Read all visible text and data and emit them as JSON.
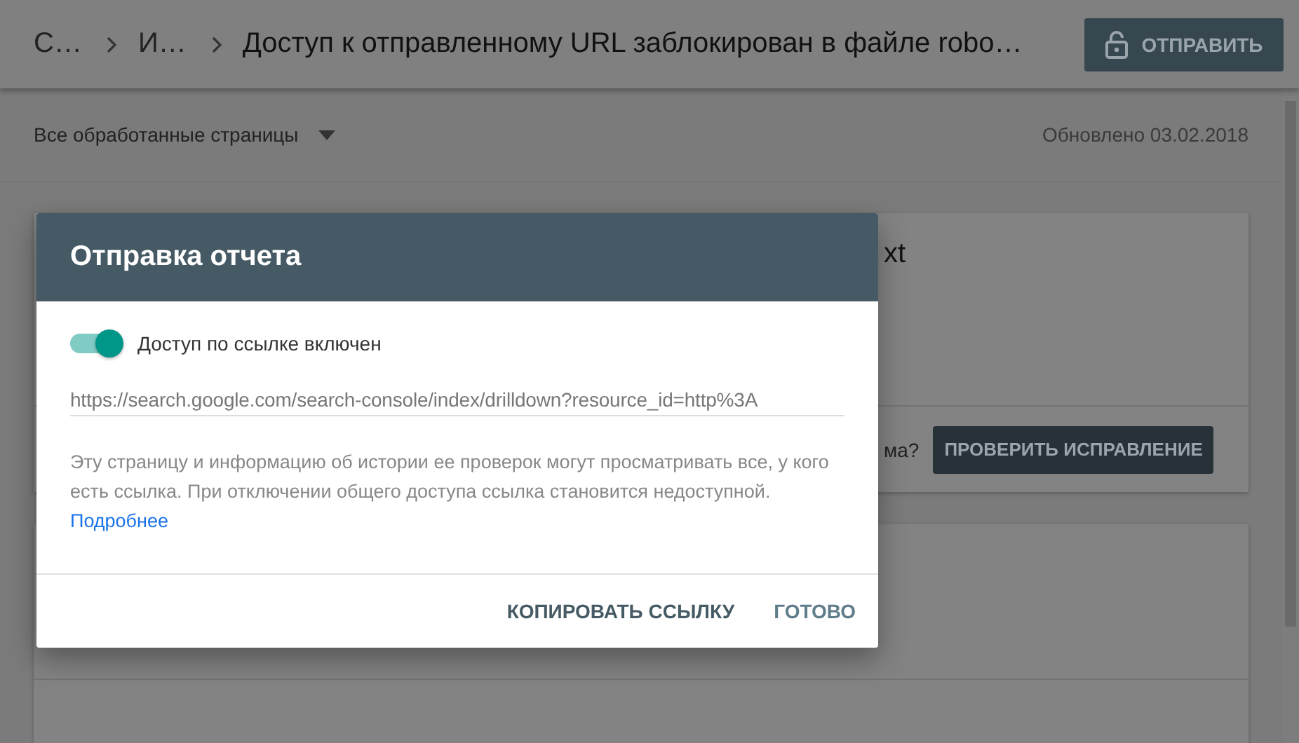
{
  "header": {
    "breadcrumbs": [
      "С…",
      "И…"
    ],
    "title": "Доступ к отправленному URL заблокирован в файле robo…",
    "submit_button": "ОТПРАВИТЬ"
  },
  "toolbar": {
    "filter": "Все обработанные страницы",
    "updated": "Обновлено 03.02.2018"
  },
  "background": {
    "card_title_fragment": "xt",
    "question_fragment": "ма?",
    "validate_button": "ПРОВЕРИТЬ ИСПРАВЛЕНИЕ"
  },
  "dialog": {
    "title": "Отправка отчета",
    "sharing": {
      "label": "Доступ по ссылке включен",
      "on": true
    },
    "link": "https://search.google.com/search-console/index/drilldown?resource_id=http%3A",
    "description": "Эту страницу и информацию об истории ее проверок могут просматривать все, у кого есть ссылка. При отключении общего доступа ссылка становится недоступной.",
    "learn_more": "Подробнее",
    "buttons": [
      {
        "label": "КОПИРОВАТЬ ССЫЛКУ",
        "kind": "strong"
      },
      {
        "label": "ГОТОВО",
        "kind": "light"
      }
    ]
  }
}
